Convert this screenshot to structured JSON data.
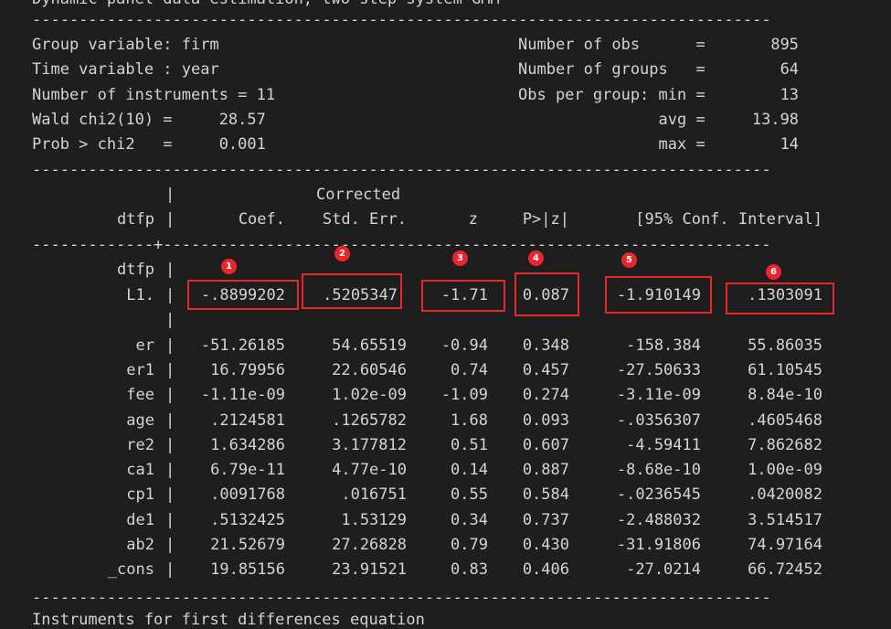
{
  "title_line": "Dynamic panel-data estimation, two-step system GMM",
  "dash_line": "-------------------------------------------------------------------------------",
  "header_left": [
    "Group variable: firm",
    "Time variable : year",
    "Number of instruments = 11",
    "Wald chi2(10) =     28.57",
    "Prob > chi2   =     0.001"
  ],
  "header_right": [
    "Number of obs      =       895",
    "Number of groups   =        64",
    "Obs per group: min =        13",
    "               avg =     13.98",
    "               max =        14"
  ],
  "col_headers": {
    "pipe": "|",
    "corrected": "Corrected",
    "depvar": "dtfp",
    "coef": "Coef.",
    "stderr": "Std. Err.",
    "z": "z",
    "p": "P>|z|",
    "ci": "[95% Conf. Interval]"
  },
  "separator_line": "-------------+-----------------------------------------------------------------",
  "lag_group": {
    "var": "dtfp",
    "pipe": "|"
  },
  "l1_row": {
    "var": "L1.",
    "pipe": "|",
    "coef": "-.8899202",
    "se": ".5205347",
    "z": "-1.71",
    "p": "0.087",
    "lo": "-1.910149",
    "hi": ".1303091"
  },
  "blank_pipe": "|",
  "rows": [
    {
      "var": "er",
      "pipe": "|",
      "coef": "-51.26185",
      "se": "54.65519",
      "z": "-0.94",
      "p": "0.348",
      "lo": "-158.384",
      "hi": "55.86035"
    },
    {
      "var": "er1",
      "pipe": "|",
      "coef": "16.79956",
      "se": "22.60546",
      "z": "0.74",
      "p": "0.457",
      "lo": "-27.50633",
      "hi": "61.10545"
    },
    {
      "var": "fee",
      "pipe": "|",
      "coef": "-1.11e-09",
      "se": "1.02e-09",
      "z": "-1.09",
      "p": "0.274",
      "lo": "-3.11e-09",
      "hi": "8.84e-10"
    },
    {
      "var": "age",
      "pipe": "|",
      "coef": ".2124581",
      "se": ".1265782",
      "z": "1.68",
      "p": "0.093",
      "lo": "-.0356307",
      "hi": ".4605468"
    },
    {
      "var": "re2",
      "pipe": "|",
      "coef": "1.634286",
      "se": "3.177812",
      "z": "0.51",
      "p": "0.607",
      "lo": "-4.59411",
      "hi": "7.862682"
    },
    {
      "var": "ca1",
      "pipe": "|",
      "coef": "6.79e-11",
      "se": "4.77e-10",
      "z": "0.14",
      "p": "0.887",
      "lo": "-8.68e-10",
      "hi": "1.00e-09"
    },
    {
      "var": "cp1",
      "pipe": "|",
      "coef": ".0091768",
      "se": ".016751",
      "z": "0.55",
      "p": "0.584",
      "lo": "-.0236545",
      "hi": ".0420082"
    },
    {
      "var": "de1",
      "pipe": "|",
      "coef": ".5132425",
      "se": "1.53129",
      "z": "0.34",
      "p": "0.737",
      "lo": "-2.488032",
      "hi": "3.514517"
    },
    {
      "var": "ab2",
      "pipe": "|",
      "coef": "21.52679",
      "se": "27.26828",
      "z": "0.79",
      "p": "0.430",
      "lo": "-31.91806",
      "hi": "74.97164"
    },
    {
      "var": "_cons",
      "pipe": "|",
      "coef": "19.85156",
      "se": "23.91521",
      "z": "0.83",
      "p": "0.406",
      "lo": "-27.0214",
      "hi": "66.72452"
    }
  ],
  "bottom_line": "Instruments for first differences equation",
  "badges": [
    "1",
    "2",
    "3",
    "4",
    "5",
    "6"
  ],
  "colors": {
    "background": "#1e1e1e",
    "text": "#d4d4d4",
    "highlight": "#e8262b"
  }
}
